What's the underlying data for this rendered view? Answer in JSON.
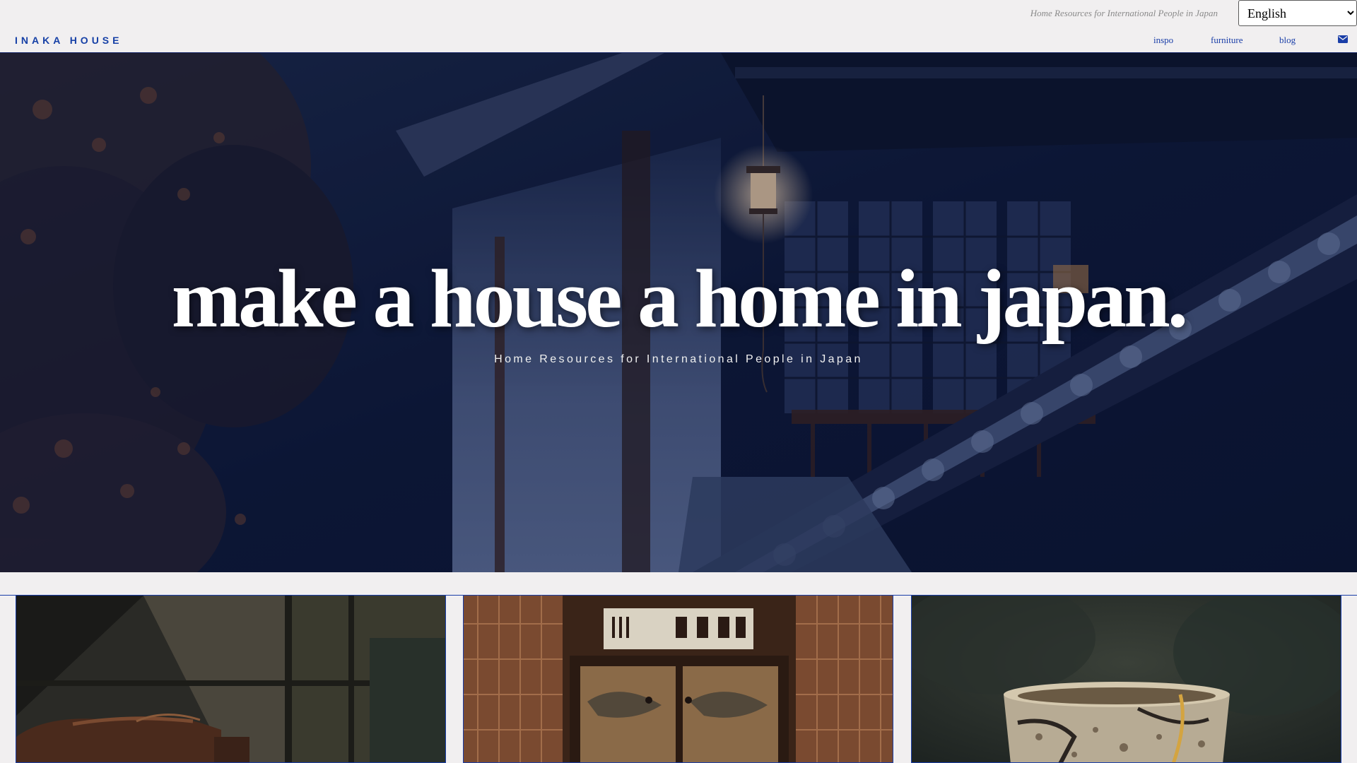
{
  "header": {
    "tagline": "Home Resources for International People in Japan",
    "language_selected": "English",
    "logo": "INAKA HOUSE",
    "nav": [
      {
        "label": "inspo"
      },
      {
        "label": "furniture"
      },
      {
        "label": "blog"
      }
    ],
    "contact_icon": "envelope-icon"
  },
  "hero": {
    "title": "make a house a home in japan.",
    "subtitle": "Home Resources for International People in Japan"
  },
  "colors": {
    "brand_blue": "#1640a6",
    "page_background": "#f1eff0",
    "hero_overlay": "#0f1a3a"
  }
}
